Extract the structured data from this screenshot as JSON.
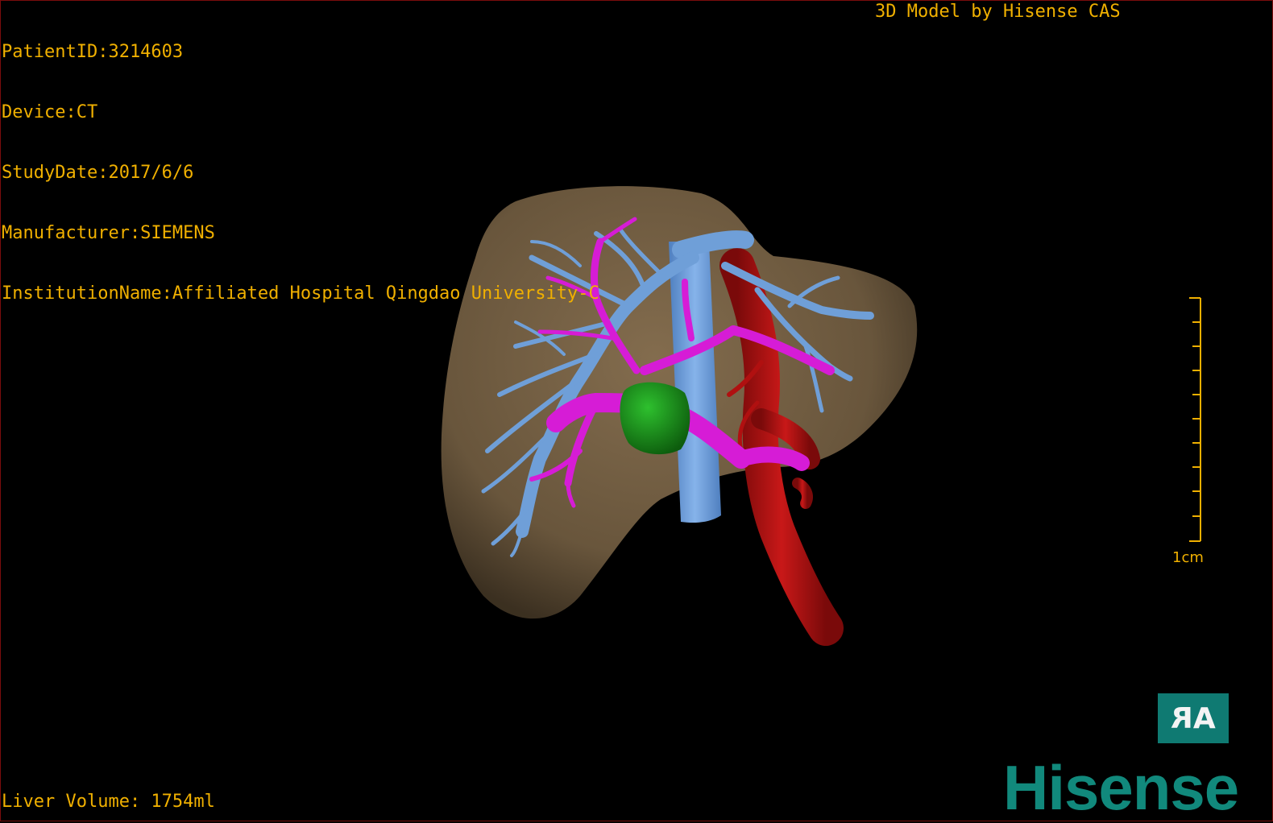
{
  "patient_info": {
    "patient_id": "PatientID:3214603",
    "device": "Device:CT",
    "study_date": "StudyDate:2017/6/6",
    "manufacturer": "Manufacturer:SIEMENS",
    "institution": "InstitutionName:Affiliated Hospital Qingdao University-C"
  },
  "credit": "3D Model by Hisense CAS",
  "liver_volume": "Liver Volume: 1754ml",
  "scale_bar": {
    "label": "1cm"
  },
  "orientation_button": {
    "label_flipped": "R",
    "label": "A"
  },
  "logo": "Hisense",
  "colors": {
    "overlay_text": "#f0b000",
    "liver": "#7a6548",
    "portal_vein": "#6f9fd8",
    "hepatic_artery": "#d61cd6",
    "aorta": "#b01010",
    "tumor": "#1a8a1a",
    "logo": "#11897c",
    "border": "#7a0c0c"
  }
}
